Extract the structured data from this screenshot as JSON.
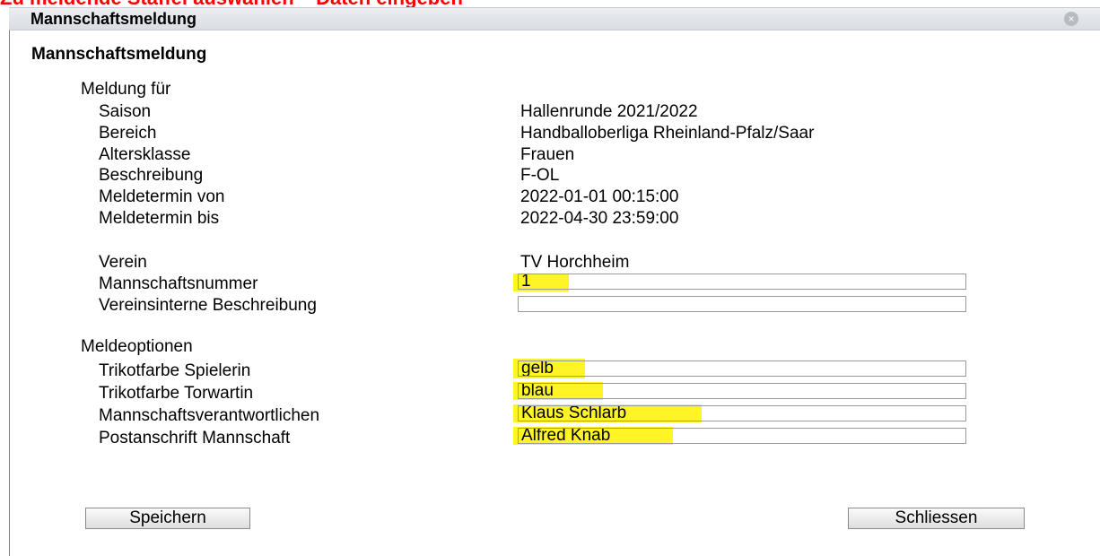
{
  "banner": "Zu meldende Staffel auswählen – Daten eingeben",
  "window": {
    "title": "Mannschaftsmeldung"
  },
  "heading": "Mannschaftsmeldung",
  "meldung": {
    "section_label": "Meldung für",
    "saison_label": "Saison",
    "saison_value": "Hallenrunde 2021/2022",
    "bereich_label": "Bereich",
    "bereich_value": "Handballoberliga Rheinland-Pfalz/Saar",
    "altersklasse_label": "Altersklasse",
    "altersklasse_value": "Frauen",
    "beschreibung_label": "Beschreibung",
    "beschreibung_value": "F-OL",
    "meldetermin_von_label": "Meldetermin von",
    "meldetermin_von_value": "2022-01-01 00:15:00",
    "meldetermin_bis_label": "Meldetermin bis",
    "meldetermin_bis_value": "2022-04-30 23:59:00"
  },
  "verein": {
    "verein_label": "Verein",
    "verein_value": "TV Horchheim",
    "mannschaftsnummer_label": "Mannschaftsnummer",
    "mannschaftsnummer_value": "1",
    "vereinsinterne_label": "Vereinsinterne Beschreibung",
    "vereinsinterne_value": ""
  },
  "optionen": {
    "section_label": "Meldeoptionen",
    "trikot_spielerin_label": "Trikotfarbe Spielerin",
    "trikot_spielerin_value": "gelb",
    "trikot_torwartin_label": "Trikotfarbe Torwartin",
    "trikot_torwartin_value": "blau",
    "verantwortlichen_label": "Mannschaftsverantwortlichen",
    "verantwortlichen_value": "Klaus Schlarb",
    "postanschrift_label": "Postanschrift Mannschaft",
    "postanschrift_value": "Alfred Knab"
  },
  "buttons": {
    "save": "Speichern",
    "close": "Schliessen"
  },
  "colors": {
    "highlight": "#fff200",
    "banner": "#ff0000"
  }
}
